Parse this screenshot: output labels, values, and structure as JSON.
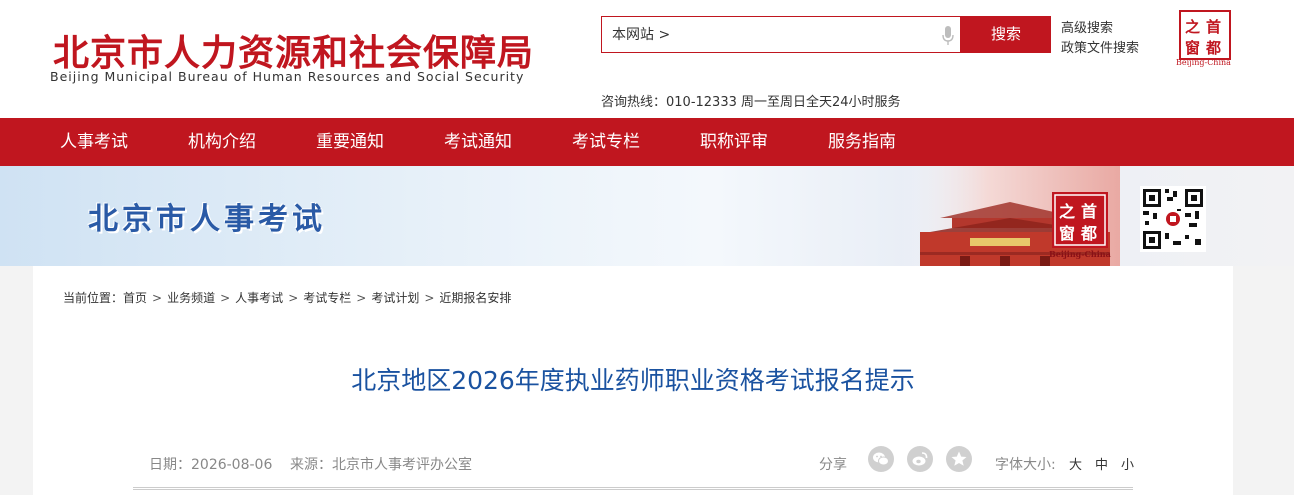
{
  "header": {
    "logo_cn": "北京市人力资源和社会保障局",
    "logo_en": "Beijing Municipal Bureau of Human Resources and Social Security",
    "search": {
      "scope": "本网站 >",
      "button": "搜索"
    },
    "advanced_search": "高级搜索",
    "policy_search": "政策文件搜索",
    "seal": {
      "chars": [
        "之",
        "首",
        "窗",
        "都"
      ],
      "en": "Beijing-China"
    },
    "hotline": "咨询热线：010-12333 周一至周日全天24小时服务",
    "brand_color": "#c0161f"
  },
  "nav": {
    "items": [
      "人事考试",
      "机构介绍",
      "重要通知",
      "考试通知",
      "考试专栏",
      "职称评审",
      "服务指南"
    ]
  },
  "banner": {
    "title": "北京市人事考试",
    "seal_en": "Beijing-China"
  },
  "breadcrumb": {
    "prefix": "当前位置：",
    "items": [
      "首页",
      "业务频道",
      "人事考试",
      "考试专栏",
      "考试计划",
      "近期报名安排"
    ],
    "separator": ">"
  },
  "article": {
    "title": "北京地区2026年度执业药师职业资格考试报名提示",
    "date": "日期：2026-08-06",
    "source": "来源：北京市人事考评办公室",
    "share_label": "分享",
    "share_icons": [
      "wechat-icon",
      "weibo-icon",
      "favorite-star-icon"
    ],
    "font_label": "字体大小:",
    "font_sizes": [
      "大",
      "中",
      "小"
    ],
    "title_color": "#1a52a0"
  }
}
